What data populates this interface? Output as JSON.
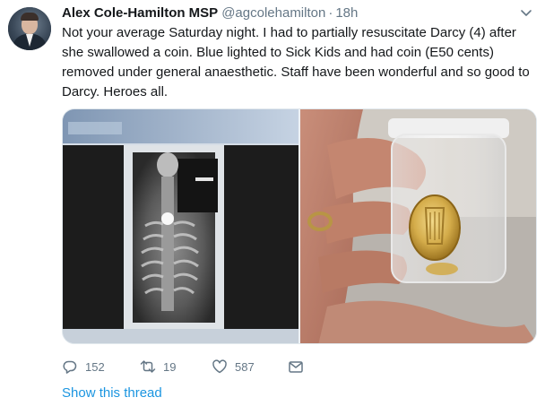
{
  "tweet": {
    "author_name": "Alex Cole-Hamilton MSP",
    "handle": "@agcolehamilton",
    "separator": "·",
    "time": "18h",
    "text": "Not your average Saturday night. I had to partially resuscitate Darcy (4) after she swallowed a coin. Blue lighted to Sick Kids and had coin (E50 cents) removed under general anaesthetic. Staff have been wonderful and so good to Darcy. Heroes all."
  },
  "actions": {
    "reply_count": "152",
    "retweet_count": "19",
    "like_count": "587"
  },
  "thread_link": "Show this thread",
  "icons": {
    "reply": "reply-icon",
    "retweet": "retweet-icon",
    "like": "heart-icon",
    "dm": "envelope-icon",
    "menu": "chevron-down-icon"
  },
  "colors": {
    "text": "#14171a",
    "secondary": "#657786",
    "link": "#1b95e0",
    "border": "#e1e8ed"
  }
}
